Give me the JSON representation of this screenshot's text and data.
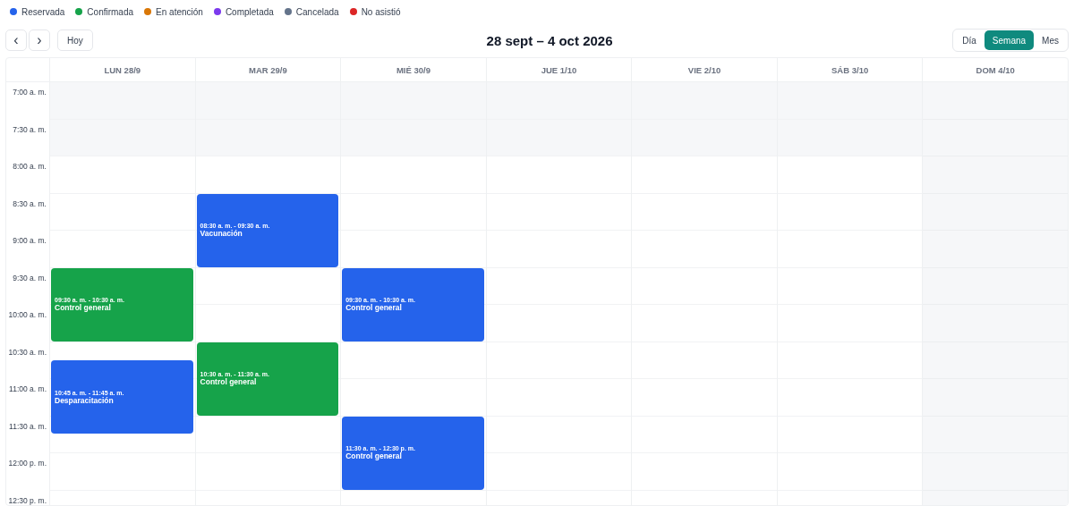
{
  "legend": [
    {
      "label": "Reservada",
      "color": "#2563eb"
    },
    {
      "label": "Confirmada",
      "color": "#16a34a"
    },
    {
      "label": "En atención",
      "color": "#d97706"
    },
    {
      "label": "Completada",
      "color": "#7c3aed"
    },
    {
      "label": "Cancelada",
      "color": "#64748b"
    },
    {
      "label": "No asistió",
      "color": "#dc2626"
    }
  ],
  "toolbar": {
    "prev": "‹",
    "next": "›",
    "today": "Hoy",
    "title": "28 sept – 4 oct 2026",
    "views": [
      {
        "label": "Día",
        "selected": false
      },
      {
        "label": "Semana",
        "selected": true
      },
      {
        "label": "Mes",
        "selected": false
      }
    ]
  },
  "days": [
    {
      "label": "LUN 28/9",
      "events": [
        {
          "time": "09:30 a. m. - 10:30 a. m.",
          "title": "Control general",
          "color": "#16a34a"
        },
        {
          "time": "10:45 a. m. - 11:45 a. m.",
          "title": "Desparacitación",
          "color": "#2563eb"
        }
      ]
    },
    {
      "label": "MAR 29/9",
      "events": [
        {
          "time": "08:30 a. m. - 09:30 a. m.",
          "title": "Vacunación",
          "color": "#2563eb"
        },
        {
          "time": "10:30 a. m. - 11:30 a. m.",
          "title": "Control general",
          "color": "#16a34a"
        }
      ]
    },
    {
      "label": "MIÉ 30/9",
      "events": [
        {
          "time": "09:30 a. m. - 10:30 a. m.",
          "title": "Control general",
          "color": "#2563eb"
        },
        {
          "time": "11:30 a. m. - 12:30 p. m.",
          "title": "Control general",
          "color": "#2563eb"
        }
      ]
    },
    {
      "label": "JUE 1/10"
    },
    {
      "label": "VIE 2/10"
    },
    {
      "label": "SÁB 3/10"
    },
    {
      "label": "DOM 4/10"
    }
  ],
  "slots": [
    "7:00 a. m.",
    "7:30 a. m.",
    "8:00 a. m.",
    "8:30 a. m.",
    "9:00 a. m.",
    "9:30 a. m.",
    "10:00 a. m.",
    "10:30 a. m.",
    "11:00 a. m.",
    "11:30 a. m.",
    "12:00 p. m.",
    "12:30 p. m."
  ]
}
